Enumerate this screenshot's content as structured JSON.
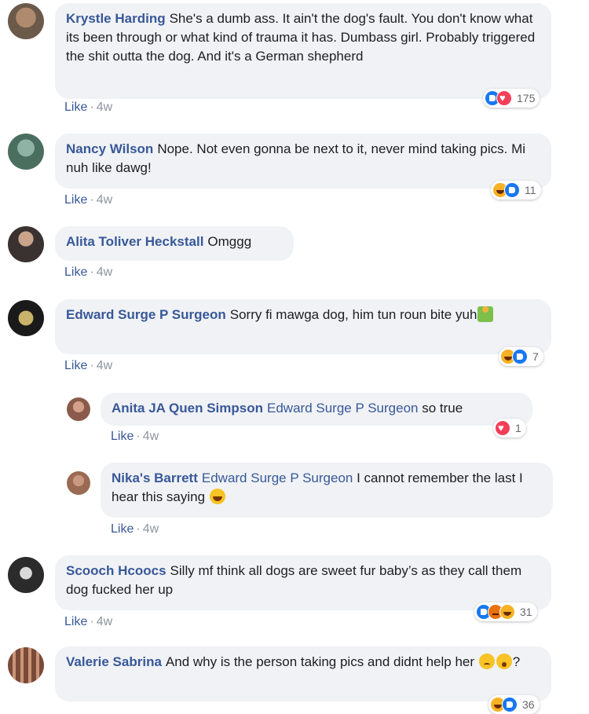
{
  "comments": [
    {
      "name": "Krystle Harding",
      "text": "She's a dumb ass. It ain't the dog's fault. You don't know what its been through or what kind of trauma it has. Dumbass girl. Probably triggered the shit outta the dog. And it's a German shepherd",
      "like_label": "Like",
      "time": "4w",
      "reaction_count": "175",
      "reactions": [
        "like-icon",
        "love-icon"
      ],
      "avatar_color": "#6b5a4a"
    },
    {
      "name": "Nancy Wilson",
      "text": "Nope. Not even gonna be next to it, never mind taking pics. Mi nuh like dawg!",
      "like_label": "Like",
      "time": "4w",
      "reaction_count": "11",
      "reactions": [
        "haha-icon",
        "like-icon"
      ],
      "avatar_color": "#4a6f5e"
    },
    {
      "name": "Alita Toliver Heckstall",
      "text": "Omggg",
      "like_label": "Like",
      "time": "4w",
      "avatar_color": "#3a3230"
    },
    {
      "name": "Edward Surge P Surgeon",
      "text": "Sorry fi mawga dog, him tun roun bite yuh",
      "like_label": "Like",
      "time": "4w",
      "reaction_count": "7",
      "reactions": [
        "haha-icon",
        "like-icon"
      ],
      "avatar_color": "#1a1a1a"
    },
    {
      "name": "Anita JA Quen Simpson",
      "mention": "Edward Surge P Surgeon",
      "text": "so true",
      "like_label": "Like",
      "time": "4w",
      "reaction_count": "1",
      "reactions": [
        "love-icon"
      ],
      "avatar_color": "#8a5b4a"
    },
    {
      "name": "Nika's Barrett",
      "mention": "Edward Surge P Surgeon",
      "text": "I cannot remember the last I hear this saying",
      "like_label": "Like",
      "time": "4w",
      "avatar_color": "#9a6a52"
    },
    {
      "name": "Scooch Hcoocs",
      "text": "Silly mf think all dogs are sweet fur baby’s as they call them dog fucked her up",
      "like_label": "Like",
      "time": "4w",
      "reaction_count": "31",
      "reactions": [
        "like-icon",
        "angry-icon",
        "haha-icon"
      ],
      "avatar_color": "#2b2b2b"
    },
    {
      "name": "Valerie Sabrina",
      "text": "And why is the person taking pics and didnt help her",
      "text_end": "?",
      "reaction_count": "36",
      "reactions": [
        "haha-icon",
        "like-icon"
      ],
      "avatar_color": "#7a4a38"
    }
  ]
}
